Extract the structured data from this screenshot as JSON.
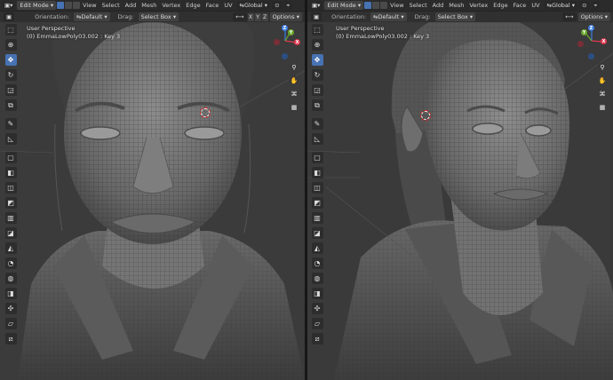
{
  "left": {
    "mode": "Edit Mode",
    "menus": [
      "View",
      "Select",
      "Add",
      "Mesh",
      "Vertex",
      "Edge",
      "Face",
      "UV"
    ],
    "transform": "Global",
    "toolbar": {
      "orientation_label": "Orientation:",
      "orientation_value": "Default",
      "drag_label": "Drag:",
      "drag_value": "Select Box",
      "axes": [
        "X",
        "Y",
        "Z"
      ],
      "options": "Options"
    },
    "overlay": {
      "view": "User Perspective",
      "object": "(0) EmmaLowPoly03.002 : Key 3"
    }
  },
  "right": {
    "mode": "Edit Mode",
    "menus": [
      "View",
      "Select",
      "Add",
      "Mesh",
      "Vertex",
      "Edge",
      "Face",
      "UV"
    ],
    "transform": "Global",
    "toolbar": {
      "orientation_label": "Orientation:",
      "orientation_value": "Default",
      "drag_label": "Drag:",
      "drag_value": "Select Box",
      "options": "Options"
    },
    "overlay": {
      "view": "User Perspective",
      "object": "(0) EmmaLowPoly03.002 : Key 3"
    }
  },
  "gizmo": {
    "x": "X",
    "y": "Y",
    "z": "Z"
  },
  "icons": [
    "select-icon",
    "cursor-icon",
    "move-icon",
    "rotate-icon",
    "scale-icon",
    "transform-icon",
    "annotate-icon",
    "measure-icon",
    "add-cube-icon",
    "extrude-icon",
    "inset-icon",
    "bevel-icon",
    "loop-cut-icon",
    "knife-icon",
    "poly-build-icon",
    "spin-icon",
    "smooth-icon",
    "edge-slide-icon",
    "shrink-fatten-icon",
    "shear-icon",
    "rip-icon"
  ],
  "colors": {
    "header": "#2b2b2b",
    "toolbar": "#303030",
    "viewport": "#3a3a3a",
    "active_blue": "#4772b3",
    "axis_x": "#e0374d",
    "axis_y": "#6aa82b",
    "axis_z": "#3d7de0"
  }
}
